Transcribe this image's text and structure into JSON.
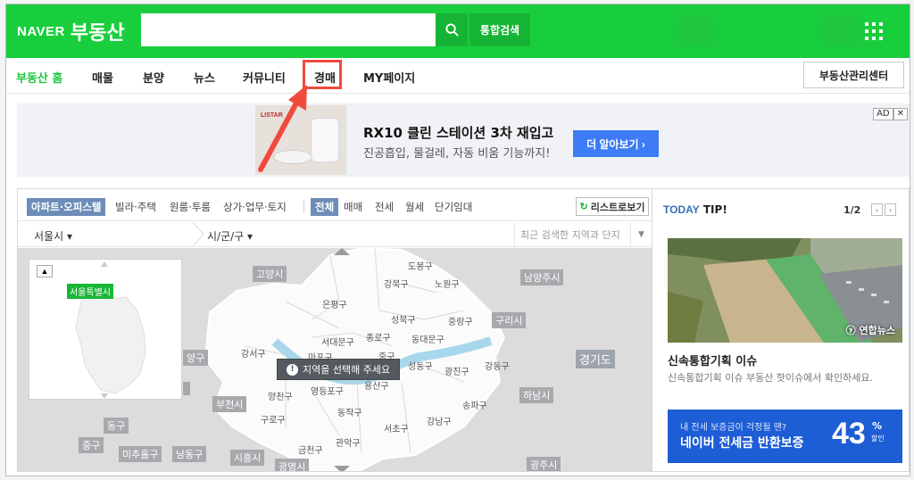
{
  "header": {
    "logo_naver": "NAVER",
    "logo_service": "부동산",
    "search_placeholder": "",
    "unified_search": "통합검색"
  },
  "nav": {
    "items": [
      "부동산 홈",
      "매물",
      "분양",
      "뉴스",
      "커뮤니티",
      "경매",
      "MY페이지"
    ],
    "active": "부동산 홈",
    "highlighted": "경매",
    "manager_center": "부동산관리센터"
  },
  "ad": {
    "brand": "LISTAR",
    "title": "RX10 클린 스테이션 3차 재입고",
    "subtitle": "진공흡입, 물걸레, 자동 비움 기능까지!",
    "button": "더 알아보기 ›",
    "badge": "AD",
    "badge_close": "✕"
  },
  "map": {
    "filters": [
      "아파트·오피스텔",
      "빌라·주택",
      "원룸·투룸",
      "상가·업무·토지"
    ],
    "trade_types": [
      "전체",
      "매매",
      "전세",
      "월세",
      "단기임대"
    ],
    "list_view": "리스트로보기",
    "city": "서울시",
    "district": "시/군/구",
    "recent_search": "최근 검색한 지역과 단지",
    "mini_label": "서울특별시",
    "tooltip": "지역을 선택해 주세요",
    "regions": [
      "고양시",
      "남양주시",
      "구리시",
      "경기도",
      "하남시",
      "부천시",
      "동구",
      "중구",
      "미추홀구",
      "남동구",
      "시흥시",
      "광명시",
      "광주시",
      "양구"
    ],
    "districts": [
      "도봉구",
      "강북구",
      "노원구",
      "은평구",
      "성북구",
      "중랑구",
      "서대문구",
      "종로구",
      "동대문구",
      "마포구",
      "중구",
      "강서구",
      "성동구",
      "광진구",
      "강동구",
      "양천구",
      "영등포구",
      "용산구",
      "동작구",
      "송파구",
      "구로구",
      "서초구",
      "강남구",
      "관악구",
      "금천구"
    ]
  },
  "side": {
    "today": "TODAY",
    "tip": "TIP!",
    "pager": "1/2",
    "prev": "‹",
    "next": "›",
    "image_credit": "연합뉴스",
    "caption": "신속통합기획 이슈",
    "description": "신속통합기획 이슈 부동산 핫이슈에서 확인하세요.",
    "banner_line1": "내 전세 보증금이 걱정될 땐?",
    "banner_line2": "네이버 전세금 반환보증",
    "banner_percent": "43",
    "banner_percent_sign": "%",
    "banner_percent_label": "할인"
  }
}
